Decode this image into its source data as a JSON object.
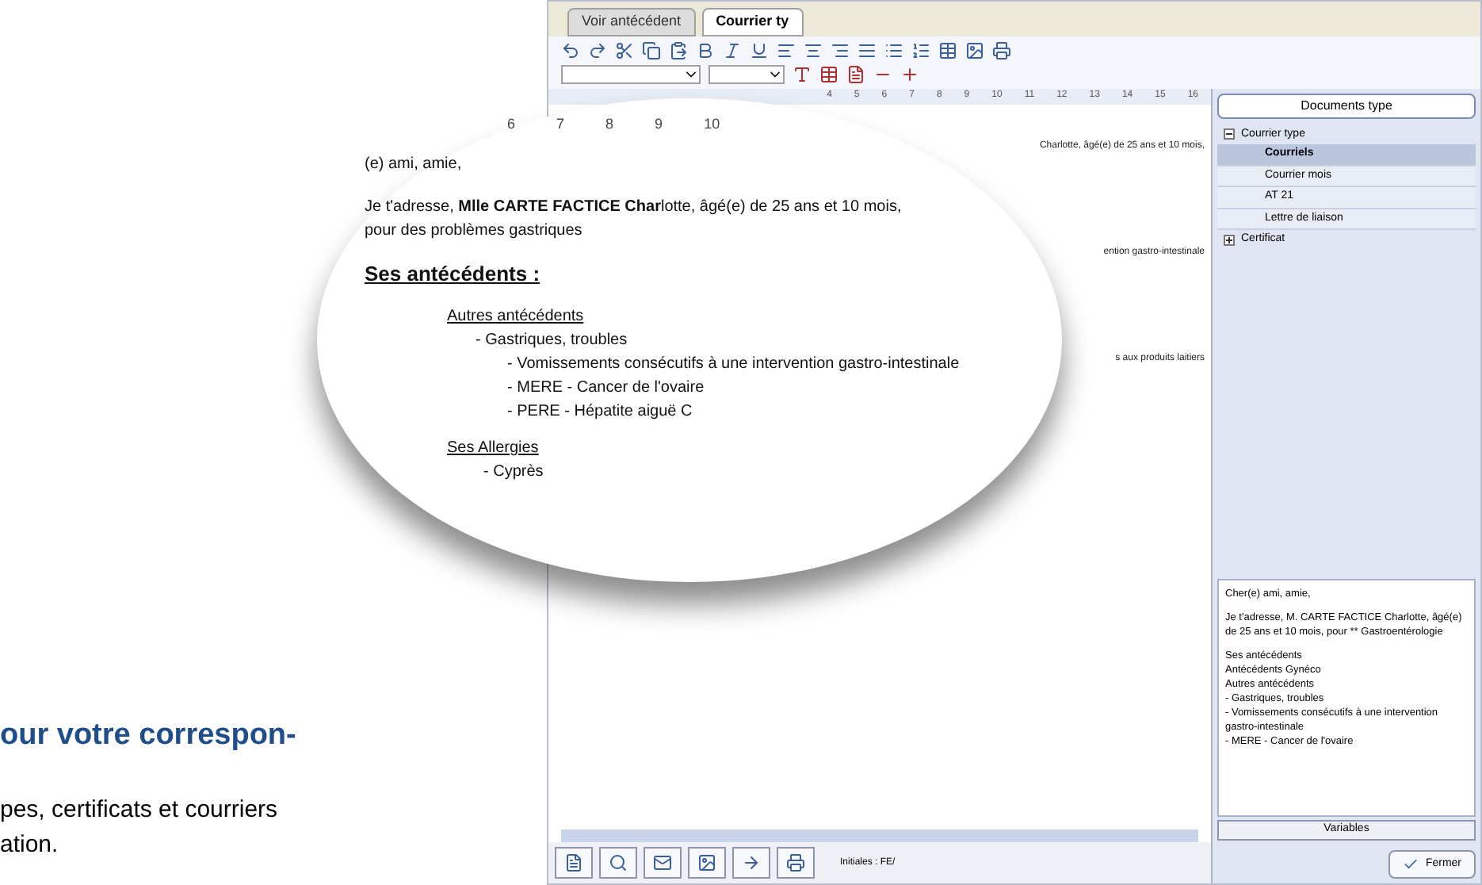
{
  "brochure": {
    "heading": "our votre correspon-",
    "body_lines": [
      "pes, certificats et courriers",
      "ation."
    ]
  },
  "window": {
    "tabs": [
      {
        "label": "Voir antécédent",
        "selected": false
      },
      {
        "label": "Courrier ty",
        "selected": true
      }
    ],
    "ruler": [
      "4",
      "5",
      "6",
      "7",
      "8",
      "9",
      "10",
      "11",
      "12",
      "13",
      "14",
      "15",
      "16"
    ],
    "document_fragments": [
      "Charlotte, âgé(e) de 25 ans et 10 mois,",
      "ention gastro-intestinale",
      "s aux produits laitiers"
    ],
    "status": "Initiales : FE/",
    "side_panel": {
      "header_button": "Documents type",
      "tree": [
        {
          "label": "Courrier type",
          "expanded": true,
          "children": [
            {
              "label": "Courriels",
              "selected": true
            },
            {
              "label": "Courrier mois",
              "selected": false
            },
            {
              "label": "AT 21",
              "selected": false
            },
            {
              "label": "Lettre de liaison",
              "selected": false
            }
          ]
        },
        {
          "label": "Certificat",
          "expanded": false
        }
      ],
      "preview_paragraphs": [
        [
          "Cher(e) ami, amie,"
        ],
        [
          "Je t'adresse, M. CARTE FACTICE Charlotte, âgé(e) de 25 ans et 10 mois, pour ** Gastroentérologie"
        ],
        [
          "Ses antécédents",
          "Antécédents Gynéco",
          "Autres antécédents",
          "- Gastriques, troubles",
          "- Vomissements consécutifs à une intervention gastro-intestinale",
          "- MERE - Cancer de l'ovaire"
        ]
      ],
      "variables_button": "Variables",
      "close_button": "Fermer"
    }
  },
  "magnifier": {
    "ruler": [
      "6",
      "7",
      "8",
      "9",
      "10"
    ],
    "greeting": "(e) ami, amie,",
    "intro": "Je t'adresse, **Mlle CARTE FACTICE Char**lotte, âgé(e) de 25 ans et 10 mois,",
    "intro_2": "pour des problèmes gastriques",
    "section": "Ses antécédents :",
    "subsection": "Autres antécédents",
    "items": [
      "- Gastriques, troubles",
      "- Vomissements consécutifs à une intervention gastro-intestinale",
      "- MERE - Cancer de l'ovaire",
      "- PERE - Hépatite aiguë C"
    ],
    "subsection_2": "Ses Allergies",
    "items_2": [
      "- Cyprès"
    ]
  }
}
